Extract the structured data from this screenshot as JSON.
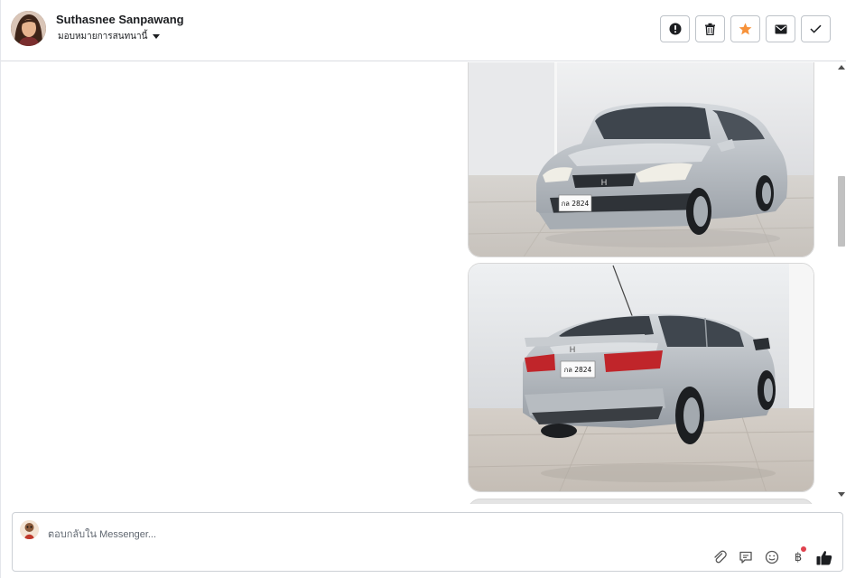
{
  "header": {
    "contact_name": "Suthasnee Sanpawang",
    "assign_label": "มอบหมายการสนทนานี้",
    "actions": [
      {
        "icon": "alert-circle-icon"
      },
      {
        "icon": "trash-icon"
      },
      {
        "icon": "star-icon",
        "color": "#f7923a"
      },
      {
        "icon": "envelope-icon"
      },
      {
        "icon": "checkmark-icon"
      }
    ]
  },
  "messages": {
    "photos": [
      {
        "subject": "car-front-view",
        "plate": "กล 2824"
      },
      {
        "subject": "car-rear-view",
        "plate": "กล 2824"
      }
    ]
  },
  "composer": {
    "placeholder": "ตอบกลับใน Messenger...",
    "tools": [
      "paperclip-icon",
      "saved-reply-icon",
      "emoji-icon",
      "baht-payment-icon",
      "thumbs-up-icon"
    ],
    "baht_symbol": "฿"
  }
}
